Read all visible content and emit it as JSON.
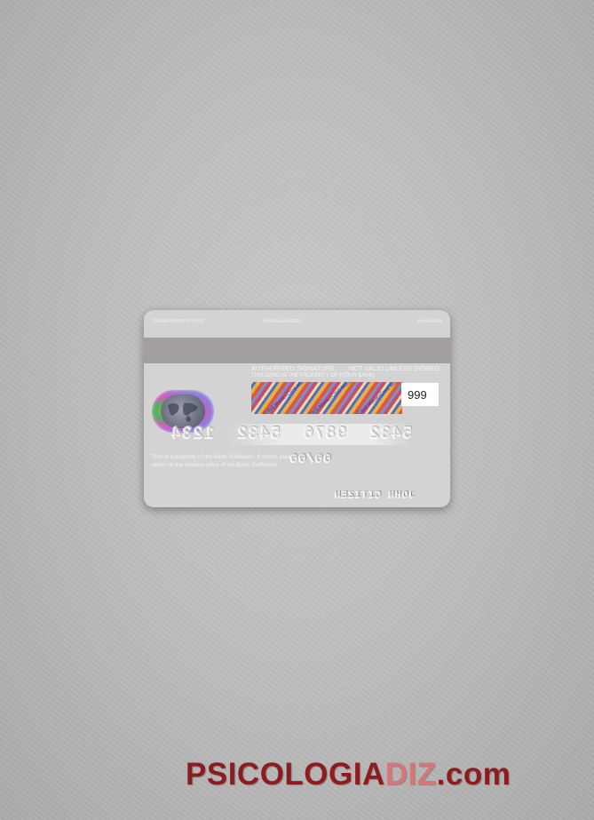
{
  "card": {
    "top_left": "ICADAS 0000000 00/00",
    "top_center": "##AAAAAAA0000",
    "top_right": "##AAAAAA",
    "signature_label": "AUTHORIZED SIGNATURE",
    "not_valid_label": "NOT VALID UNLESS SIGNED",
    "property_line": "THIS CARD IS THE PROPERTY OF {YOUR BANK}",
    "panel_text": "MasterCard MasterCard MasterCard",
    "cvv": "999",
    "number_embossed": "5432  9876  5432  1234",
    "notice_line1": "This is a property of the Bank Raiffeisen. If found, please",
    "notice_line2": "return to the nearest office of the Bank Raiffeisen.",
    "expiry_embossed": "00/00",
    "name_embossed": "JOHN CITIZEN"
  },
  "watermark": {
    "part1": "PSICOLOGIA",
    "part2": "DIZ",
    "part3": ".com",
    "color_main": "#8e1c1e",
    "color_accent": "#d5767a"
  }
}
